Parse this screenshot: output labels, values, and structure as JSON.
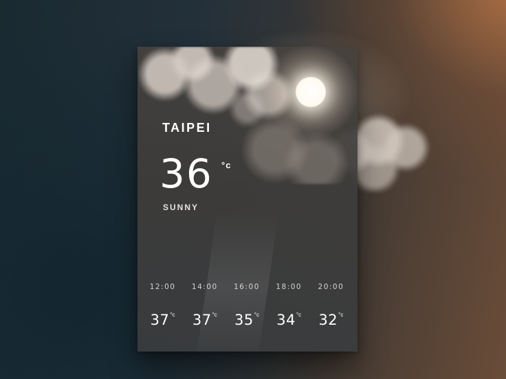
{
  "weather": {
    "city": "TAIPEI",
    "current_temp": "36",
    "current_unit": "°c",
    "condition": "SUNNY",
    "condition_icon": "sun-icon"
  },
  "forecast": [
    {
      "time": "12:00",
      "temp": "37",
      "unit": "°c"
    },
    {
      "time": "14:00",
      "temp": "37",
      "unit": "°c"
    },
    {
      "time": "16:00",
      "temp": "35",
      "unit": "°c"
    },
    {
      "time": "18:00",
      "temp": "34",
      "unit": "°c"
    },
    {
      "time": "20:00",
      "temp": "32",
      "unit": "°c"
    }
  ]
}
